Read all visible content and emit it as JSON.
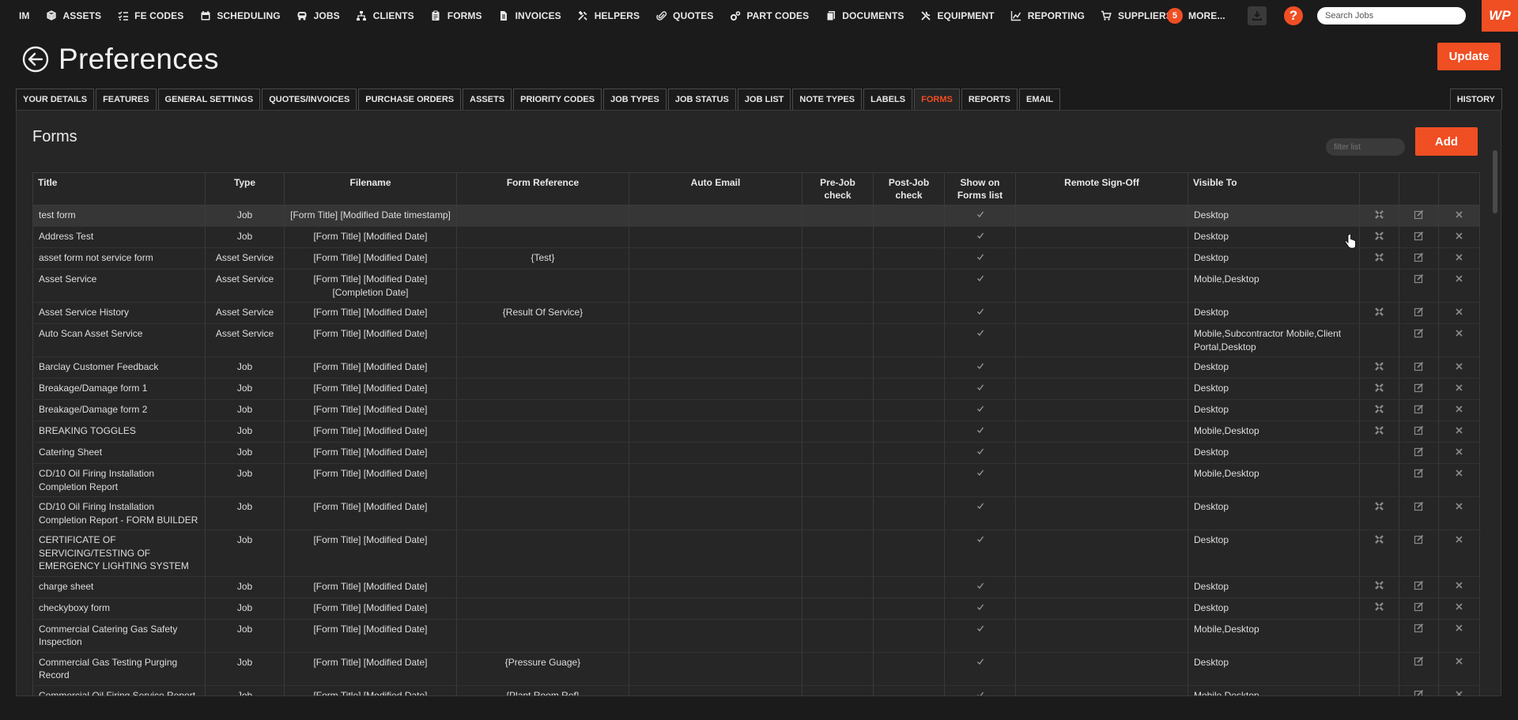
{
  "nav": {
    "items": [
      {
        "label": "IM",
        "icon": ""
      },
      {
        "label": "ASSETS",
        "icon": "cube-icon"
      },
      {
        "label": "FE CODES",
        "icon": "checklist-icon"
      },
      {
        "label": "SCHEDULING",
        "icon": "calendar-icon"
      },
      {
        "label": "JOBS",
        "icon": "van-icon"
      },
      {
        "label": "CLIENTS",
        "icon": "sitemap-icon"
      },
      {
        "label": "FORMS",
        "icon": "clipboard-icon"
      },
      {
        "label": "INVOICES",
        "icon": "document-icon"
      },
      {
        "label": "HELPERS",
        "icon": "tools-icon"
      },
      {
        "label": "QUOTES",
        "icon": "paperclip-icon"
      },
      {
        "label": "PART CODES",
        "icon": "gears-icon"
      },
      {
        "label": "DOCUMENTS",
        "icon": "documents-icon"
      },
      {
        "label": "EQUIPMENT",
        "icon": "wrench-icon"
      },
      {
        "label": "REPORTING",
        "icon": "chart-icon"
      },
      {
        "label": "SUPPLIERS",
        "icon": "cart-icon"
      }
    ],
    "more_count": "5",
    "more_label": "MORE...",
    "help_label": "?",
    "search_placeholder": "Search Jobs",
    "logo_text": "WP"
  },
  "header": {
    "title": "Preferences",
    "update_label": "Update"
  },
  "tabs": [
    {
      "label": "YOUR DETAILS",
      "active": false
    },
    {
      "label": "FEATURES",
      "active": false
    },
    {
      "label": "GENERAL SETTINGS",
      "active": false
    },
    {
      "label": "QUOTES/INVOICES",
      "active": false
    },
    {
      "label": "PURCHASE ORDERS",
      "active": false
    },
    {
      "label": "ASSETS",
      "active": false
    },
    {
      "label": "PRIORITY CODES",
      "active": false
    },
    {
      "label": "JOB TYPES",
      "active": false
    },
    {
      "label": "JOB STATUS",
      "active": false
    },
    {
      "label": "JOB LIST",
      "active": false
    },
    {
      "label": "NOTE TYPES",
      "active": false
    },
    {
      "label": "LABELS",
      "active": false
    },
    {
      "label": "FORMS",
      "active": true
    },
    {
      "label": "REPORTS",
      "active": false
    },
    {
      "label": "EMAIL",
      "active": false
    }
  ],
  "history_label": "HISTORY",
  "forms": {
    "title": "Forms",
    "filter_placeholder": "filter list",
    "add_label": "Add",
    "columns": [
      "Title",
      "Type",
      "Filename",
      "Form Reference",
      "Auto Email",
      "Pre-Job check",
      "Post-Job check",
      "Show on Forms list",
      "Remote Sign-Off",
      "Visible To"
    ],
    "rows": [
      {
        "title": "test form",
        "type": "Job",
        "filename": "[Form Title] [Modified Date timestamp]",
        "ref": "",
        "auto_email": "",
        "pre": false,
        "post": false,
        "show": true,
        "remote": "",
        "visible": "Desktop",
        "unlink": true,
        "highlight": true
      },
      {
        "title": "Address Test",
        "type": "Job",
        "filename": "[Form Title] [Modified Date]",
        "ref": "",
        "auto_email": "",
        "pre": false,
        "post": false,
        "show": true,
        "remote": "",
        "visible": "Desktop",
        "unlink": true,
        "highlight": false
      },
      {
        "title": "asset form not service form",
        "type": "Asset Service",
        "filename": "[Form Title] [Modified Date]",
        "ref": "{Test}",
        "auto_email": "",
        "pre": false,
        "post": false,
        "show": true,
        "remote": "",
        "visible": "Desktop",
        "unlink": true,
        "highlight": false
      },
      {
        "title": "Asset Service",
        "type": "Asset Service",
        "filename": "[Form Title] [Modified Date] [Completion Date]",
        "ref": "",
        "auto_email": "",
        "pre": false,
        "post": false,
        "show": true,
        "remote": "",
        "visible": "Mobile,Desktop",
        "unlink": false,
        "highlight": false
      },
      {
        "title": "Asset Service History",
        "type": "Asset Service",
        "filename": "[Form Title] [Modified Date]",
        "ref": "{Result Of Service}",
        "auto_email": "",
        "pre": false,
        "post": false,
        "show": true,
        "remote": "",
        "visible": "Desktop",
        "unlink": true,
        "highlight": false
      },
      {
        "title": "Auto Scan Asset Service",
        "type": "Asset Service",
        "filename": "[Form Title] [Modified Date]",
        "ref": "",
        "auto_email": "",
        "pre": false,
        "post": false,
        "show": true,
        "remote": "",
        "visible": "Mobile,Subcontractor Mobile,Client Portal,Desktop",
        "unlink": false,
        "highlight": false
      },
      {
        "title": "Barclay Customer Feedback",
        "type": "Job",
        "filename": "[Form Title] [Modified Date]",
        "ref": "",
        "auto_email": "",
        "pre": false,
        "post": false,
        "show": true,
        "remote": "",
        "visible": "Desktop",
        "unlink": true,
        "highlight": false
      },
      {
        "title": "Breakage/Damage form 1",
        "type": "Job",
        "filename": "[Form Title] [Modified Date]",
        "ref": "",
        "auto_email": "",
        "pre": false,
        "post": false,
        "show": true,
        "remote": "",
        "visible": "Desktop",
        "unlink": true,
        "highlight": false
      },
      {
        "title": "Breakage/Damage form 2",
        "type": "Job",
        "filename": "[Form Title] [Modified Date]",
        "ref": "",
        "auto_email": "",
        "pre": false,
        "post": false,
        "show": true,
        "remote": "",
        "visible": "Desktop",
        "unlink": true,
        "highlight": false
      },
      {
        "title": "BREAKING TOGGLES",
        "type": "Job",
        "filename": "[Form Title] [Modified Date]",
        "ref": "",
        "auto_email": "",
        "pre": false,
        "post": false,
        "show": true,
        "remote": "",
        "visible": "Mobile,Desktop",
        "unlink": true,
        "highlight": false
      },
      {
        "title": "Catering Sheet",
        "type": "Job",
        "filename": "[Form Title] [Modified Date]",
        "ref": "",
        "auto_email": "",
        "pre": false,
        "post": false,
        "show": true,
        "remote": "",
        "visible": "Desktop",
        "unlink": false,
        "highlight": false
      },
      {
        "title": "CD/10 Oil Firing Installation Completion Report",
        "type": "Job",
        "filename": "[Form Title] [Modified Date]",
        "ref": "",
        "auto_email": "",
        "pre": false,
        "post": false,
        "show": true,
        "remote": "",
        "visible": "Mobile,Desktop",
        "unlink": false,
        "highlight": false
      },
      {
        "title": "CD/10 Oil Firing Installation Completion Report - FORM BUILDER",
        "type": "Job",
        "filename": "[Form Title] [Modified Date]",
        "ref": "",
        "auto_email": "",
        "pre": false,
        "post": false,
        "show": true,
        "remote": "",
        "visible": "Desktop",
        "unlink": true,
        "highlight": false
      },
      {
        "title": "CERTIFICATE OF SERVICING/TESTING OF EMERGENCY LIGHTING SYSTEM",
        "type": "Job",
        "filename": "[Form Title] [Modified Date]",
        "ref": "",
        "auto_email": "",
        "pre": false,
        "post": false,
        "show": true,
        "remote": "",
        "visible": "Desktop",
        "unlink": true,
        "highlight": false
      },
      {
        "title": "charge sheet",
        "type": "Job",
        "filename": "[Form Title] [Modified Date]",
        "ref": "",
        "auto_email": "",
        "pre": false,
        "post": false,
        "show": true,
        "remote": "",
        "visible": "Desktop",
        "unlink": true,
        "highlight": false
      },
      {
        "title": "checkyboxy form",
        "type": "Job",
        "filename": "[Form Title] [Modified Date]",
        "ref": "",
        "auto_email": "",
        "pre": false,
        "post": false,
        "show": true,
        "remote": "",
        "visible": "Desktop",
        "unlink": true,
        "highlight": false
      },
      {
        "title": "Commercial Catering Gas Safety Inspection",
        "type": "Job",
        "filename": "[Form Title] [Modified Date]",
        "ref": "",
        "auto_email": "",
        "pre": false,
        "post": false,
        "show": true,
        "remote": "",
        "visible": "Mobile,Desktop",
        "unlink": false,
        "highlight": false
      },
      {
        "title": "Commercial Gas Testing Purging Record",
        "type": "Job",
        "filename": "[Form Title] [Modified Date]",
        "ref": "{Pressure Guage}",
        "auto_email": "",
        "pre": false,
        "post": false,
        "show": true,
        "remote": "",
        "visible": "Desktop",
        "unlink": false,
        "highlight": false
      },
      {
        "title": "Commercial Oil Firing Service Report",
        "type": "Job",
        "filename": "[Form Title] [Modified Date]",
        "ref": "{Plant Room Ref}",
        "auto_email": "",
        "pre": false,
        "post": false,
        "show": true,
        "remote": "",
        "visible": "Mobile,Desktop",
        "unlink": false,
        "highlight": false
      }
    ]
  },
  "colors": {
    "accent": "#f04e23",
    "background": "#1b1b1b",
    "panel": "#262626"
  }
}
